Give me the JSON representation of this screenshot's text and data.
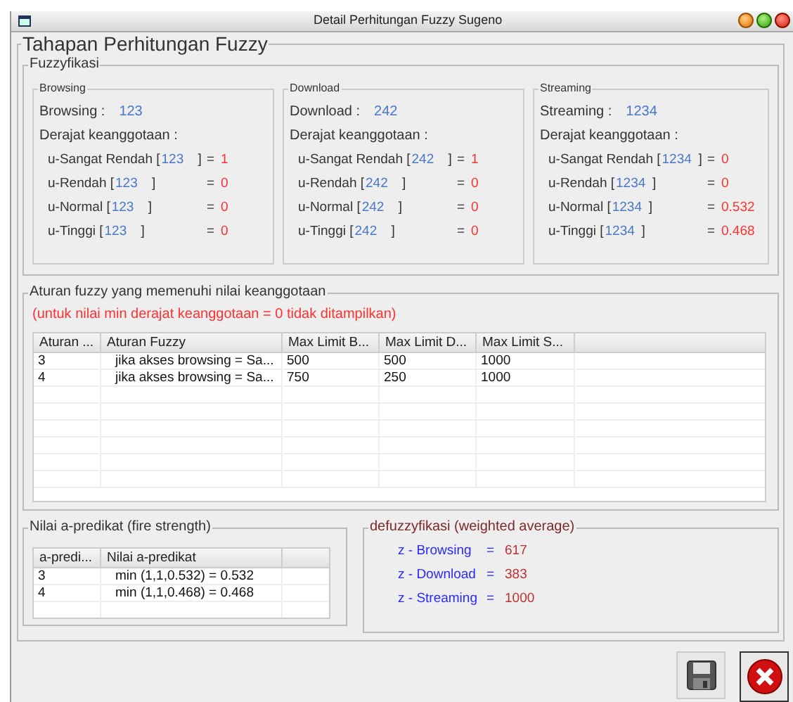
{
  "window": {
    "title": "Detail Perhitungan Fuzzy Sugeno"
  },
  "main_group": {
    "title": "Tahapan Perhitungan Fuzzy"
  },
  "fuzzyfikasi": {
    "title": "Fuzzyfikasi",
    "groups": [
      {
        "title": "Browsing",
        "input_label": "Browsing :",
        "input_value": "123",
        "degree_label": "Derajat keanggotaan :",
        "rows": [
          {
            "label": "u-Sangat Rendah [",
            "value": "123",
            "close": "]",
            "eq": "=",
            "result": "1"
          },
          {
            "label": "u-Rendah [",
            "value": "123",
            "close": "]",
            "eq": "=",
            "result": "0"
          },
          {
            "label": "u-Normal [",
            "value": "123",
            "close": "]",
            "eq": "=",
            "result": "0"
          },
          {
            "label": "u-Tinggi [",
            "value": "123",
            "close": "]",
            "eq": "=",
            "result": "0"
          }
        ]
      },
      {
        "title": "Download",
        "input_label": "Download :",
        "input_value": "242",
        "degree_label": "Derajat keanggotaan :",
        "rows": [
          {
            "label": "u-Sangat Rendah [",
            "value": "242",
            "close": "]",
            "eq": "=",
            "result": "1"
          },
          {
            "label": "u-Rendah [",
            "value": "242",
            "close": "]",
            "eq": "=",
            "result": "0"
          },
          {
            "label": "u-Normal [",
            "value": "242",
            "close": "]",
            "eq": "=",
            "result": "0"
          },
          {
            "label": "u-Tinggi [",
            "value": "242",
            "close": "]",
            "eq": "=",
            "result": "0"
          }
        ]
      },
      {
        "title": "Streaming",
        "input_label": "Streaming :",
        "input_value": "1234",
        "degree_label": "Derajat keanggotaan :",
        "rows": [
          {
            "label": "u-Sangat Rendah [",
            "value": "1234",
            "close": "]",
            "eq": "=",
            "result": "0"
          },
          {
            "label": "u-Rendah [",
            "value": "1234",
            "close": "]",
            "eq": "=",
            "result": "0"
          },
          {
            "label": "u-Normal [",
            "value": "1234",
            "close": "]",
            "eq": "=",
            "result": "0.532"
          },
          {
            "label": "u-Tinggi [",
            "value": "1234",
            "close": "]",
            "eq": "=",
            "result": "0.468"
          }
        ]
      }
    ]
  },
  "rules": {
    "title": "Aturan fuzzy yang memenuhi nilai keanggotaan",
    "note": "(untuk nilai min derajat keanggotaan = 0 tidak ditampilkan)",
    "table": {
      "columns": [
        "Aturan ...",
        "Aturan Fuzzy",
        "Max Limit B...",
        "Max Limit D...",
        "Max Limit S..."
      ],
      "rows": [
        [
          "3",
          "jika akses browsing = Sa...",
          "500",
          "500",
          "1000"
        ],
        [
          "4",
          "jika akses browsing = Sa...",
          "750",
          "250",
          "1000"
        ]
      ]
    }
  },
  "fire_strength": {
    "title": "Nilai a-predikat (fire strength)",
    "table": {
      "columns": [
        "a-predi...",
        "Nilai a-predikat"
      ],
      "rows": [
        [
          "3",
          "min (1,1,0.532) = 0.532"
        ],
        [
          "4",
          "min (1,1,0.468) = 0.468"
        ]
      ]
    }
  },
  "defuzzyfikasi": {
    "title": "defuzzyfikasi (weighted average)",
    "rows": [
      {
        "label": "z - Browsing",
        "eq": "=",
        "value": "617"
      },
      {
        "label": "z - Download",
        "eq": "=",
        "value": "383"
      },
      {
        "label": "z - Streaming",
        "eq": "=",
        "value": "1000"
      }
    ]
  }
}
